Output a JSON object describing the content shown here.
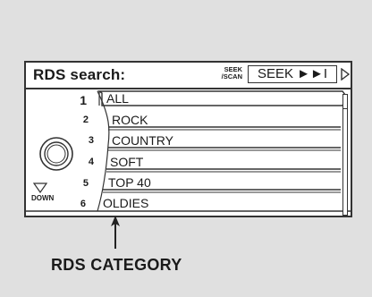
{
  "screen": {
    "title": "RDS search:",
    "seek_small_line1": "SEEK",
    "seek_small_line2": "/SCAN",
    "seek_button": "SEEK ►►I"
  },
  "categories": [
    {
      "number": "1",
      "label": "ALL"
    },
    {
      "number": "2",
      "label": "ROCK"
    },
    {
      "number": "3",
      "label": "COUNTRY"
    },
    {
      "number": "4",
      "label": "SOFT"
    },
    {
      "number": "5",
      "label": "TOP 40"
    },
    {
      "number": "6",
      "label": "OLDIES"
    }
  ],
  "knob": {
    "down_label": "DOWN"
  },
  "callout": {
    "label": "RDS CATEGORY"
  },
  "colors": {
    "background": "#e0e0e0",
    "display": "#ffffff",
    "ink": "#1a1a1a"
  }
}
